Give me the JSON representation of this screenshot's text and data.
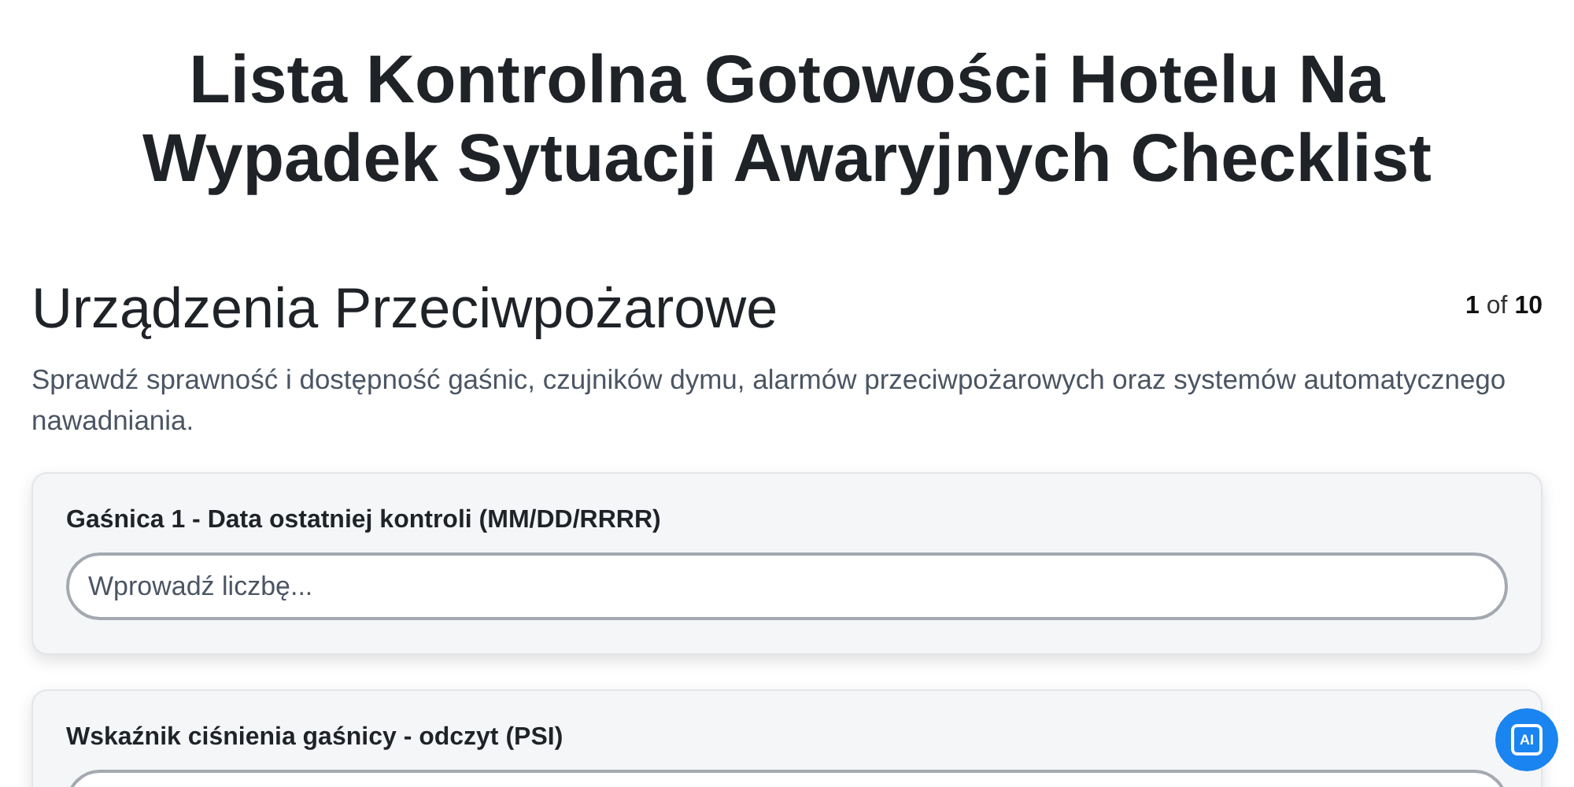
{
  "title": "Lista Kontrolna Gotowości Hotelu Na Wypadek Sytuacji Awaryjnych Checklist",
  "section": {
    "heading": "Urządzenia Przeciwpożarowe",
    "counter": {
      "current": "1",
      "separator": "of",
      "total": "10"
    },
    "description": "Sprawdź sprawność i dostępność gaśnic, czujników dymu, alarmów przeciwpożarowych oraz systemów automatycznego nawadniania."
  },
  "questions": [
    {
      "label": "Gaśnica 1 - Data ostatniej kontroli (MM/DD/RRRR)",
      "placeholder": "Wprowadź liczbę..."
    },
    {
      "label": "Wskaźnik ciśnienia gaśnicy - odczyt (PSI)"
    }
  ],
  "ai_button": {
    "label": "AI"
  }
}
